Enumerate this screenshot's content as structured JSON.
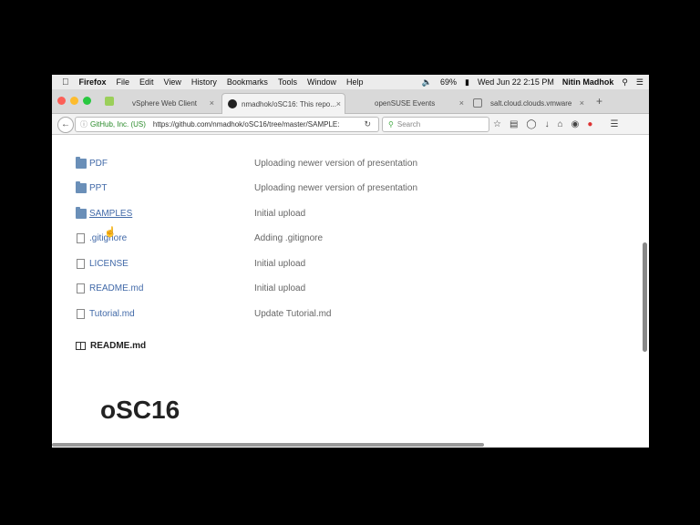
{
  "menubar": {
    "app": "Firefox",
    "items": [
      "File",
      "Edit",
      "View",
      "History",
      "Bookmarks",
      "Tools",
      "Window",
      "Help"
    ],
    "battery": "69%",
    "datetime": "Wed Jun 22  2:15 PM",
    "user": "Nitin Madhok"
  },
  "tabs": [
    {
      "title": "vSphere Web Client"
    },
    {
      "title": "nmadhok/oSC16: This repo..."
    },
    {
      "title": "openSUSE Events"
    },
    {
      "title": "salt.cloud.clouds.vmware"
    }
  ],
  "nav": {
    "secure_label": "GitHub, Inc. (US)",
    "url": "https://github.com/nmadhok/oSC16/tree/master/SAMPLE:",
    "search_placeholder": "Search"
  },
  "files": [
    {
      "name": "PDF",
      "type": "folder",
      "message": "Uploading newer version of presentation"
    },
    {
      "name": "PPT",
      "type": "folder",
      "message": "Uploading newer version of presentation"
    },
    {
      "name": "SAMPLES",
      "type": "folder",
      "message": "Initial upload"
    },
    {
      "name": ".gitignore",
      "type": "file",
      "message": "Adding .gitignore"
    },
    {
      "name": "LICENSE",
      "type": "file",
      "message": "Initial upload"
    },
    {
      "name": "README.md",
      "type": "file",
      "message": "Initial upload"
    },
    {
      "name": "Tutorial.md",
      "type": "file",
      "message": "Update Tutorial.md"
    }
  ],
  "readme": {
    "header": "README.md",
    "title": "oSC16"
  },
  "colors": {
    "link": "#4169a8",
    "folder": "#6a8fb8"
  }
}
